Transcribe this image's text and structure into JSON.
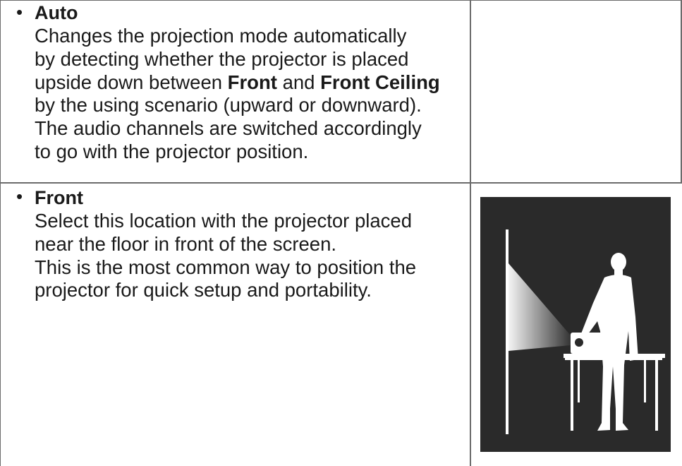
{
  "rows": [
    {
      "title": "Auto",
      "lines": [
        [
          "Changes the projection mode automatically"
        ],
        [
          "by detecting whether the projector is placed"
        ],
        [
          "upside down between ",
          {
            "b": "Front"
          },
          " and ",
          {
            "b": "Front Ceiling"
          }
        ],
        [
          "by the using scenario (upward or downward)."
        ],
        [
          "The audio channels are switched accordingly"
        ],
        [
          "to go with the projector position."
        ]
      ]
    },
    {
      "title": "Front",
      "lines": [
        [
          "Select this location with the projector placed"
        ],
        [
          "near the floor in front of the screen."
        ],
        [
          "This is the most common way to position the"
        ],
        [
          "projector for quick setup and portability."
        ]
      ]
    }
  ],
  "bullet": "•",
  "colors": {
    "text": "#1a1a1a",
    "grid": "#6b6b6b",
    "illustration_bg": "#2a2a2a",
    "illustration_fg": "#ffffff"
  },
  "icons": {
    "illustration": "front-projection-illustration"
  }
}
